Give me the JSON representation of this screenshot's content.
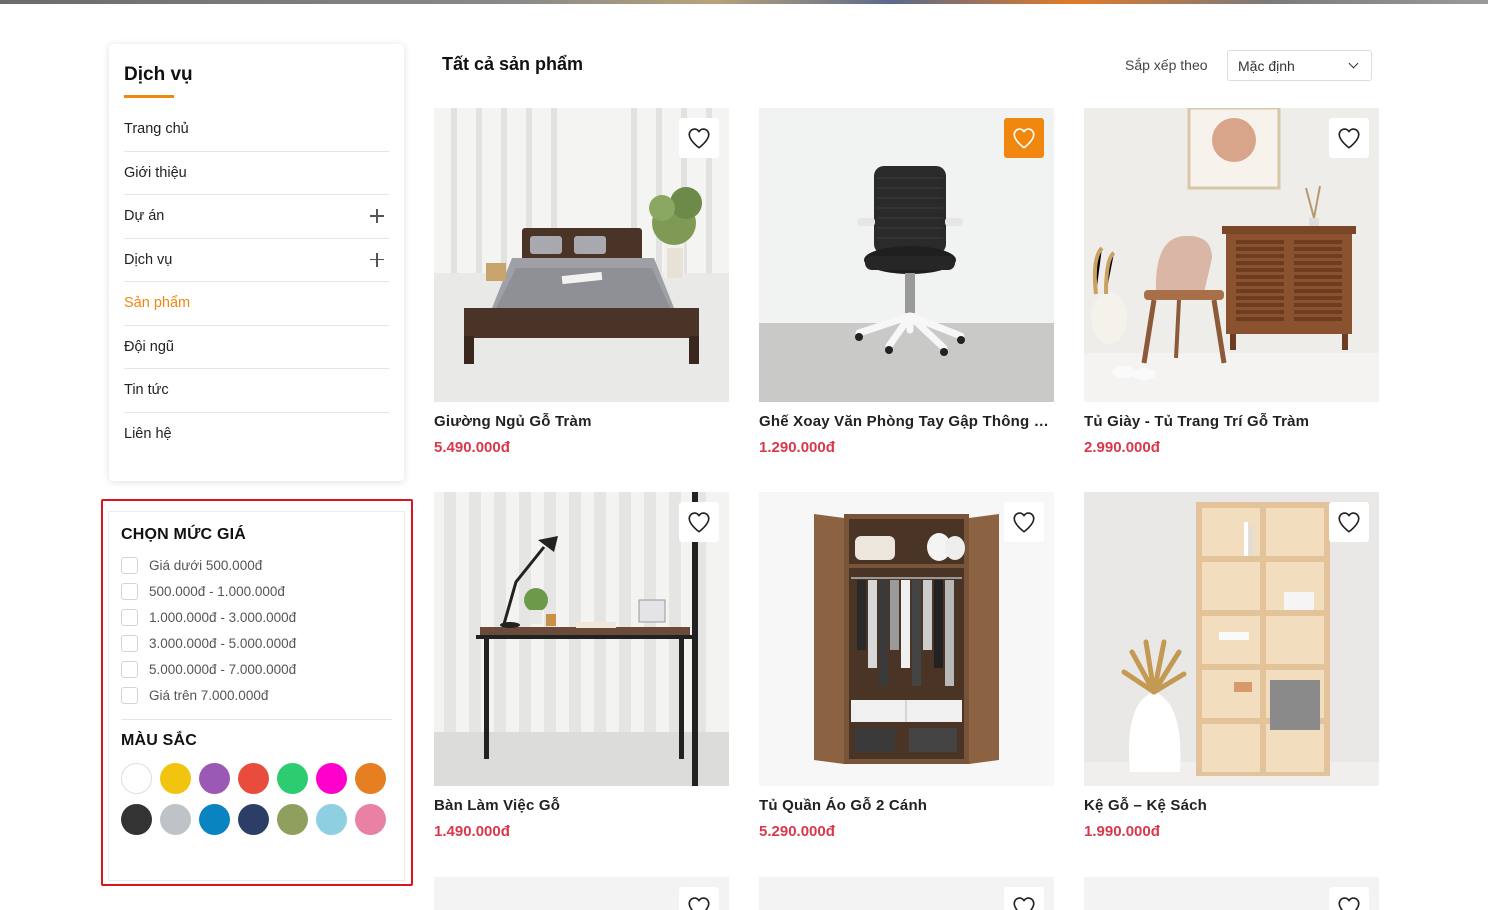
{
  "sidebar": {
    "title": "Dịch vụ",
    "items": [
      {
        "label": "Trang chủ",
        "expandable": false,
        "active": false
      },
      {
        "label": "Giới thiệu",
        "expandable": false,
        "active": false
      },
      {
        "label": "Dự án",
        "expandable": true,
        "active": false
      },
      {
        "label": "Dịch vụ",
        "expandable": true,
        "active": false
      },
      {
        "label": "Sản phẩm",
        "expandable": false,
        "active": true
      },
      {
        "label": "Đội ngũ",
        "expandable": false,
        "active": false
      },
      {
        "label": "Tin tức",
        "expandable": false,
        "active": false
      },
      {
        "label": "Liên hệ",
        "expandable": false,
        "active": false
      }
    ]
  },
  "filters": {
    "price_heading": "CHỌN MỨC GIÁ",
    "price_options": [
      "Giá dưới 500.000đ",
      "500.000đ - 1.000.000đ",
      "1.000.000đ - 3.000.000đ",
      "3.000.000đ - 5.000.000đ",
      "5.000.000đ - 7.000.000đ",
      "Giá trên 7.000.000đ"
    ],
    "color_heading": "MÀU SẮC",
    "colors": [
      "#ffffff",
      "#f1c40f",
      "#9b59b6",
      "#e74c3c",
      "#2ecc71",
      "#ff00cc",
      "#e67e22",
      "#333333",
      "#bdc3c7",
      "#0a84c1",
      "#2c3e66",
      "#8fa05e",
      "#8ecfe2",
      "#e981a4"
    ]
  },
  "main": {
    "title": "Tất cả sản phẩm",
    "sort_label": "Sắp xếp theo",
    "sort_value": "Mặc định"
  },
  "products": [
    {
      "name": "Giường Ngủ Gỗ Tràm",
      "price": "5.490.000đ",
      "favorite": false,
      "image": "bed"
    },
    {
      "name": "Ghế Xoay Văn Phòng Tay Gập Thông Minh",
      "price": "1.290.000đ",
      "favorite": true,
      "image": "office-chair"
    },
    {
      "name": "Tủ Giày - Tủ Trang Trí Gỗ Tràm",
      "price": "2.990.000đ",
      "favorite": false,
      "image": "shoe-cabinet"
    },
    {
      "name": "Bàn Làm Việc Gỗ",
      "price": "1.490.000đ",
      "favorite": false,
      "image": "desk"
    },
    {
      "name": "Tủ Quần Áo Gỗ 2 Cánh",
      "price": "5.290.000đ",
      "favorite": false,
      "image": "wardrobe"
    },
    {
      "name": "Kệ Gỗ – Kệ Sách",
      "price": "1.990.000đ",
      "favorite": false,
      "image": "bookshelf"
    }
  ]
}
